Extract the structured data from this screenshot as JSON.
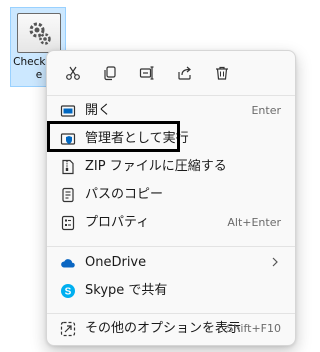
{
  "desktop_file": {
    "label": "CheckrSize",
    "icon": "settings-gear-icon"
  },
  "context_menu": {
    "quick_actions": [
      {
        "name": "cut",
        "icon": "scissors-icon"
      },
      {
        "name": "copy",
        "icon": "copy-icon"
      },
      {
        "name": "rename",
        "icon": "rename-icon"
      },
      {
        "name": "share",
        "icon": "share-icon"
      },
      {
        "name": "delete",
        "icon": "trash-icon"
      }
    ],
    "items": [
      {
        "label": "開く",
        "shortcut": "Enter",
        "icon": "open-icon"
      },
      {
        "label": "管理者として実行",
        "shortcut": "",
        "icon": "shield-icon"
      },
      {
        "label": "ZIP ファイルに圧縮する",
        "shortcut": "",
        "icon": "zip-icon"
      },
      {
        "label": "パスのコピー",
        "shortcut": "",
        "icon": "copy-path-icon"
      },
      {
        "label": "プロパティ",
        "shortcut": "Alt+Enter",
        "icon": "properties-icon"
      },
      {
        "label": "OneDrive",
        "shortcut": "",
        "icon": "onedrive-cloud-icon",
        "submenu": true
      },
      {
        "label": "Skype で共有",
        "shortcut": "",
        "icon": "skype-icon"
      },
      {
        "label": "その他のオプションを表示",
        "shortcut": "Shift+F10",
        "icon": "more-options-icon"
      }
    ]
  },
  "colors": {
    "selection_bg": "#cce8ff",
    "accent": "#0067c0",
    "onedrive": "#0a66c2",
    "skype": "#00aff0",
    "highlight_border": "#000000"
  }
}
